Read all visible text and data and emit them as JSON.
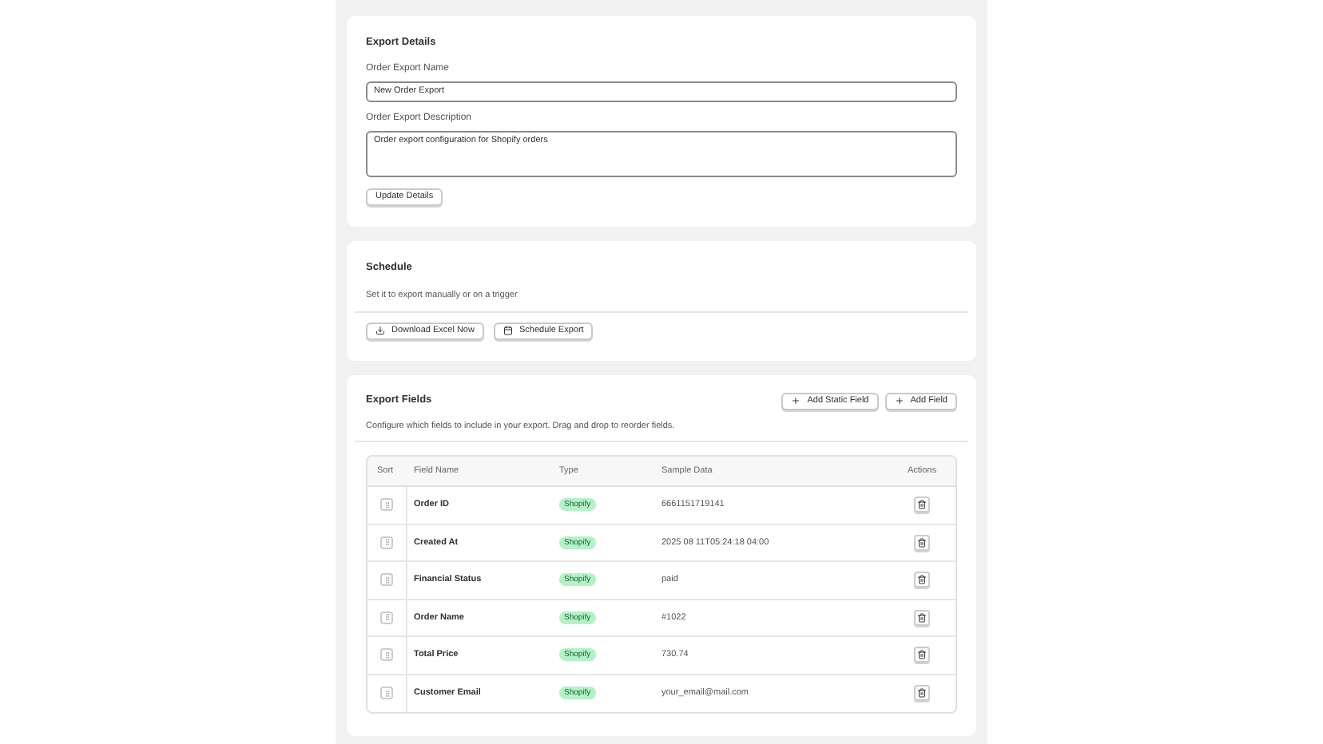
{
  "details": {
    "title": "Export Details",
    "name_label": "Order Export Name",
    "name_value": "New Order Export",
    "description_label": "Order Export Description",
    "description_value": "Order export configuration for Shopify orders",
    "update_button": "Update Details"
  },
  "schedule": {
    "title": "Schedule",
    "subtitle": "Set it to export manually or on a trigger",
    "download_button": "Download Excel Now",
    "schedule_button": "Schedule Export"
  },
  "fields": {
    "title": "Export Fields",
    "add_static_button": "Add Static Field",
    "add_field_button": "Add Field",
    "subtitle": "Configure which fields to include in your export. Drag and drop to reorder fields.",
    "table": {
      "columns": [
        "Sort",
        "Field Name",
        "Type",
        "Sample Data",
        "Actions"
      ],
      "rows": [
        {
          "field_name": "Order ID",
          "type": "Shopify",
          "sample": "6661151719141"
        },
        {
          "field_name": "Created At",
          "type": "Shopify",
          "sample": "2025 08 11T05:24:18 04:00"
        },
        {
          "field_name": "Financial Status",
          "type": "Shopify",
          "sample": "paid"
        },
        {
          "field_name": "Order Name",
          "type": "Shopify",
          "sample": "#1022"
        },
        {
          "field_name": "Total Price",
          "type": "Shopify",
          "sample": "730.74"
        },
        {
          "field_name": "Customer Email",
          "type": "Shopify",
          "sample": "your_email@mail.com"
        }
      ]
    }
  }
}
